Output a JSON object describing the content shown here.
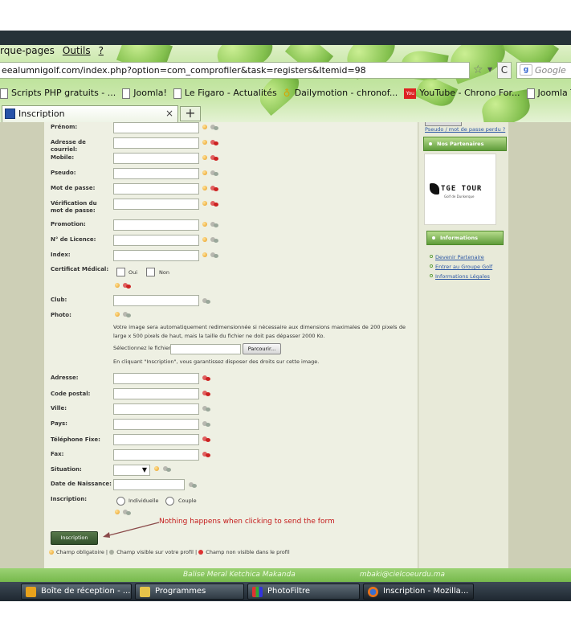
{
  "browser": {
    "menu": [
      "rque-pages",
      "Outils",
      "?"
    ],
    "url": "eealumnigolf.com/index.php?option=com_comprofiler&task=registers&Itemid=98",
    "search_placeholder": "Google",
    "bookmarks": [
      "Scripts PHP gratuits - ...",
      "Joomla!",
      "Le Figaro - Actualités",
      "Dailymotion - chronof...",
      "YouTube - Chrono For...",
      "Joomla Templates - F"
    ],
    "tab_title": "Inscription",
    "new_tab": "+"
  },
  "form": {
    "fields": [
      {
        "label": "Prénom:",
        "required": true,
        "visible": true
      },
      {
        "label": "Adresse de courriel:",
        "required": true,
        "visible": false
      },
      {
        "label": "Mobile:",
        "required": true,
        "visible": false
      },
      {
        "label": "Pseudo:",
        "required": true,
        "visible": true
      },
      {
        "label": "Mot de passe:",
        "required": true,
        "visible": false
      },
      {
        "label": "Vérification du mot de passe:",
        "required": true,
        "visible": false
      },
      {
        "label": "Promotion:",
        "required": true,
        "visible": true
      },
      {
        "label": "N° de Licence:",
        "required": true,
        "visible": true
      },
      {
        "label": "Index:",
        "required": true,
        "visible": true
      }
    ],
    "certificat": {
      "label": "Certificat Médical:",
      "oui": "Oui",
      "non": "Non"
    },
    "club_label": "Club:",
    "photo": {
      "label": "Photo:",
      "description": "Votre image sera automatiquement redimensionnée si nécessaire aux dimensions maximales de 200 pixels de large x 500 pixels de haut, mais la taille du fichier ne doit pas dépasser 2000 Ko.",
      "file_label": "Sélectionnez le fichier",
      "browse_label": "Parcourir...",
      "consent": "En cliquant \"Inscription\", vous garantissez disposer des droits sur cette image."
    },
    "address_fields": [
      {
        "label": "Adresse:",
        "visible": false
      },
      {
        "label": "Code postal:",
        "visible": false
      },
      {
        "label": "Ville:",
        "visible": true
      },
      {
        "label": "Pays:",
        "visible": true
      },
      {
        "label": "Téléphone Fixe:",
        "visible": false
      },
      {
        "label": "Fax:",
        "visible": false
      }
    ],
    "situation_label": "Situation:",
    "birthdate_label": "Date de Naissance:",
    "inscription": {
      "label": "Inscription:",
      "individuelle": "Individuelle",
      "couple": "Couple"
    },
    "submit_label": "Inscription",
    "annotation": "Nothing happens when clicking to send the form",
    "legend": {
      "required": "Champ obligatoire |",
      "visible": "Champ visible sur votre profil |",
      "hidden": "Champ non visible dans le profil"
    }
  },
  "sidebar": {
    "lost_link": "Pseudo / mot de passe perdu ?",
    "partners_title": "Nos Partenaires",
    "logo_text": "TGE TOUR",
    "logo_subtext": "Golf de Dunkerque",
    "info_title": "Informations",
    "links": [
      "Devenir Partenaire",
      "Entrer au Groupe Golf",
      "Informations Légales"
    ]
  },
  "footer_text": "Balise Meral Ketchica Makanda                            mbaki@cielcoeurdu.ma",
  "taskbar": [
    "Boîte de réception - ...",
    "Programmes",
    "PhotoFiltre",
    "Inscription - Mozilla..."
  ],
  "colors": {
    "accent_green": "#5f9c3a",
    "annotation_red": "#c41b1b",
    "link_blue": "#2a55a3"
  }
}
